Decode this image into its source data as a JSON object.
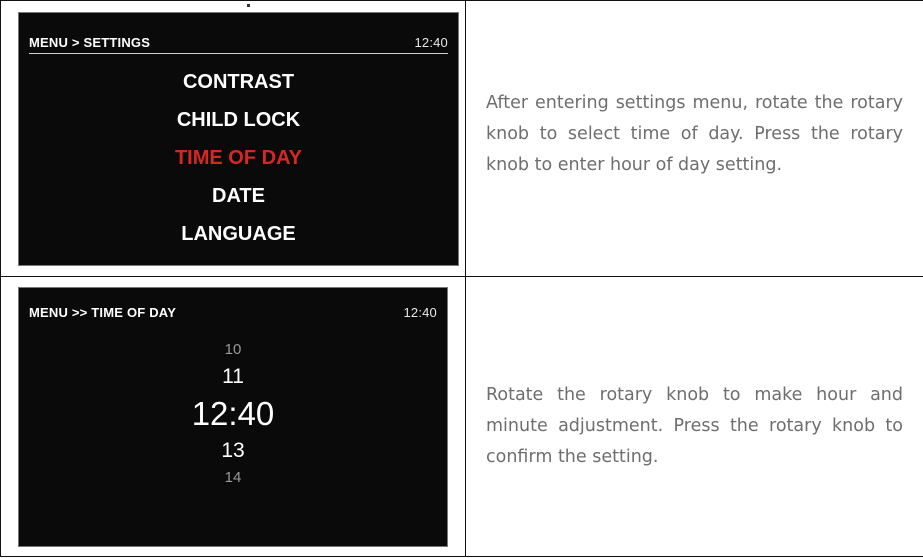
{
  "rows": [
    {
      "screen": {
        "title": "MENU > SETTINGS",
        "time": "12:40",
        "items": [
          "CONTRAST",
          "CHILD LOCK",
          "TIME OF DAY",
          "DATE",
          "LANGUAGE"
        ],
        "selected_item": "TIME OF DAY"
      },
      "caption": "After entering settings menu, rotate the rotary knob to select time of day. Press the rotary knob to enter hour of day setting."
    },
    {
      "screen": {
        "title": "MENU >> TIME OF DAY",
        "time": "12:40",
        "values": [
          "10",
          "11",
          "12:40",
          "13",
          "14"
        ]
      },
      "caption": "Rotate the rotary knob to make hour and minute adjustment. Press the rotary knob to confirm the setting."
    }
  ],
  "colors": {
    "screen_background": "#0a0a0a",
    "selected_item": "#d62822",
    "caption_text": "#6e6e6e"
  }
}
